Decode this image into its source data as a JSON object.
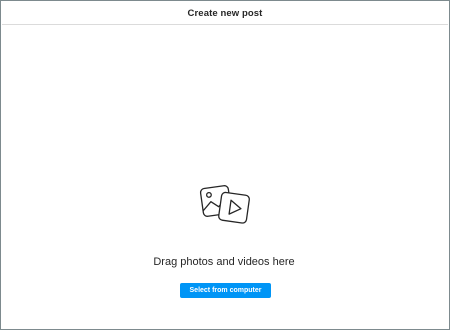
{
  "header": {
    "title": "Create new post"
  },
  "upload": {
    "icon": "photo-video-icon",
    "prompt": "Drag photos and videos here",
    "button_label": "Select from computer",
    "button_color": "#0095f6"
  }
}
